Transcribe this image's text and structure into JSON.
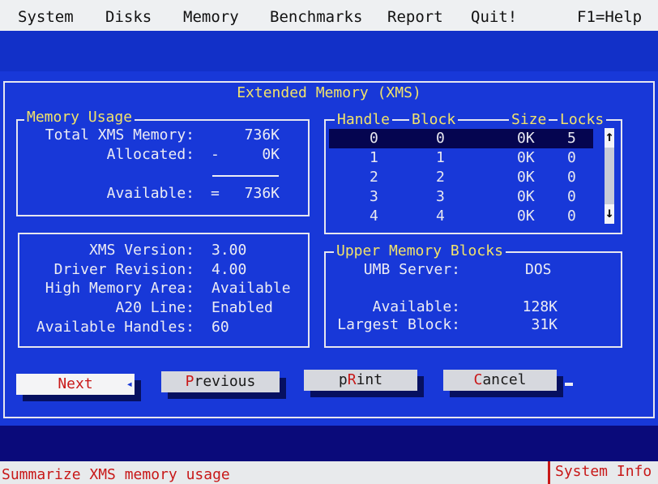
{
  "menu": [
    "System",
    "Disks",
    "Memory",
    "Benchmarks",
    "Report",
    "Quit!",
    "F1=Help"
  ],
  "window_title": "Extended Memory (XMS)",
  "memory_usage": {
    "title": "Memory Usage",
    "total_label": "Total XMS Memory:",
    "total_value": "736K",
    "allocated_label": "Allocated:",
    "allocated_op": "-",
    "allocated_value": "0K",
    "available_label": "Available:",
    "available_op": "=",
    "available_value": "736K"
  },
  "handles": {
    "headers": [
      "Handle",
      "Block",
      "Size",
      "Locks"
    ],
    "rows": [
      [
        "0",
        "0",
        "0K",
        "5"
      ],
      [
        "1",
        "1",
        "0K",
        "0"
      ],
      [
        "2",
        "2",
        "0K",
        "0"
      ],
      [
        "3",
        "3",
        "0K",
        "0"
      ],
      [
        "4",
        "4",
        "0K",
        "0"
      ]
    ],
    "scroll_up": "↑",
    "scroll_down": "↓"
  },
  "xms_info": {
    "version_label": "XMS Version:",
    "version_value": "3.00",
    "driver_label": "Driver Revision:",
    "driver_value": "4.00",
    "hma_label": "High Memory Area:",
    "hma_value": "Available",
    "a20_label": "A20 Line:",
    "a20_value": "Enabled",
    "handles_label": "Available Handles:",
    "handles_value": "60"
  },
  "umb": {
    "title": "Upper Memory Blocks",
    "server_label": "UMB Server:",
    "server_value": "DOS",
    "available_label": "Available:",
    "available_value": "128K",
    "largest_label": "Largest Block:",
    "largest_value": "31K"
  },
  "buttons": {
    "next_hotkey": "N",
    "next_rest": "ext",
    "next_marker": "◂",
    "prev_hotkey": "P",
    "prev_rest": "revious",
    "print_pre": "p",
    "print_hotkey": "R",
    "print_rest": "int",
    "cancel_hotkey": "C",
    "cancel_rest": "ancel"
  },
  "status": {
    "text": "Summarize XMS memory usage",
    "right": "System Info"
  },
  "colors": {
    "desktop": "#1838d8",
    "title": "#f2e36a",
    "hotkey": "#c81818",
    "menubar": "#eef0f2"
  }
}
